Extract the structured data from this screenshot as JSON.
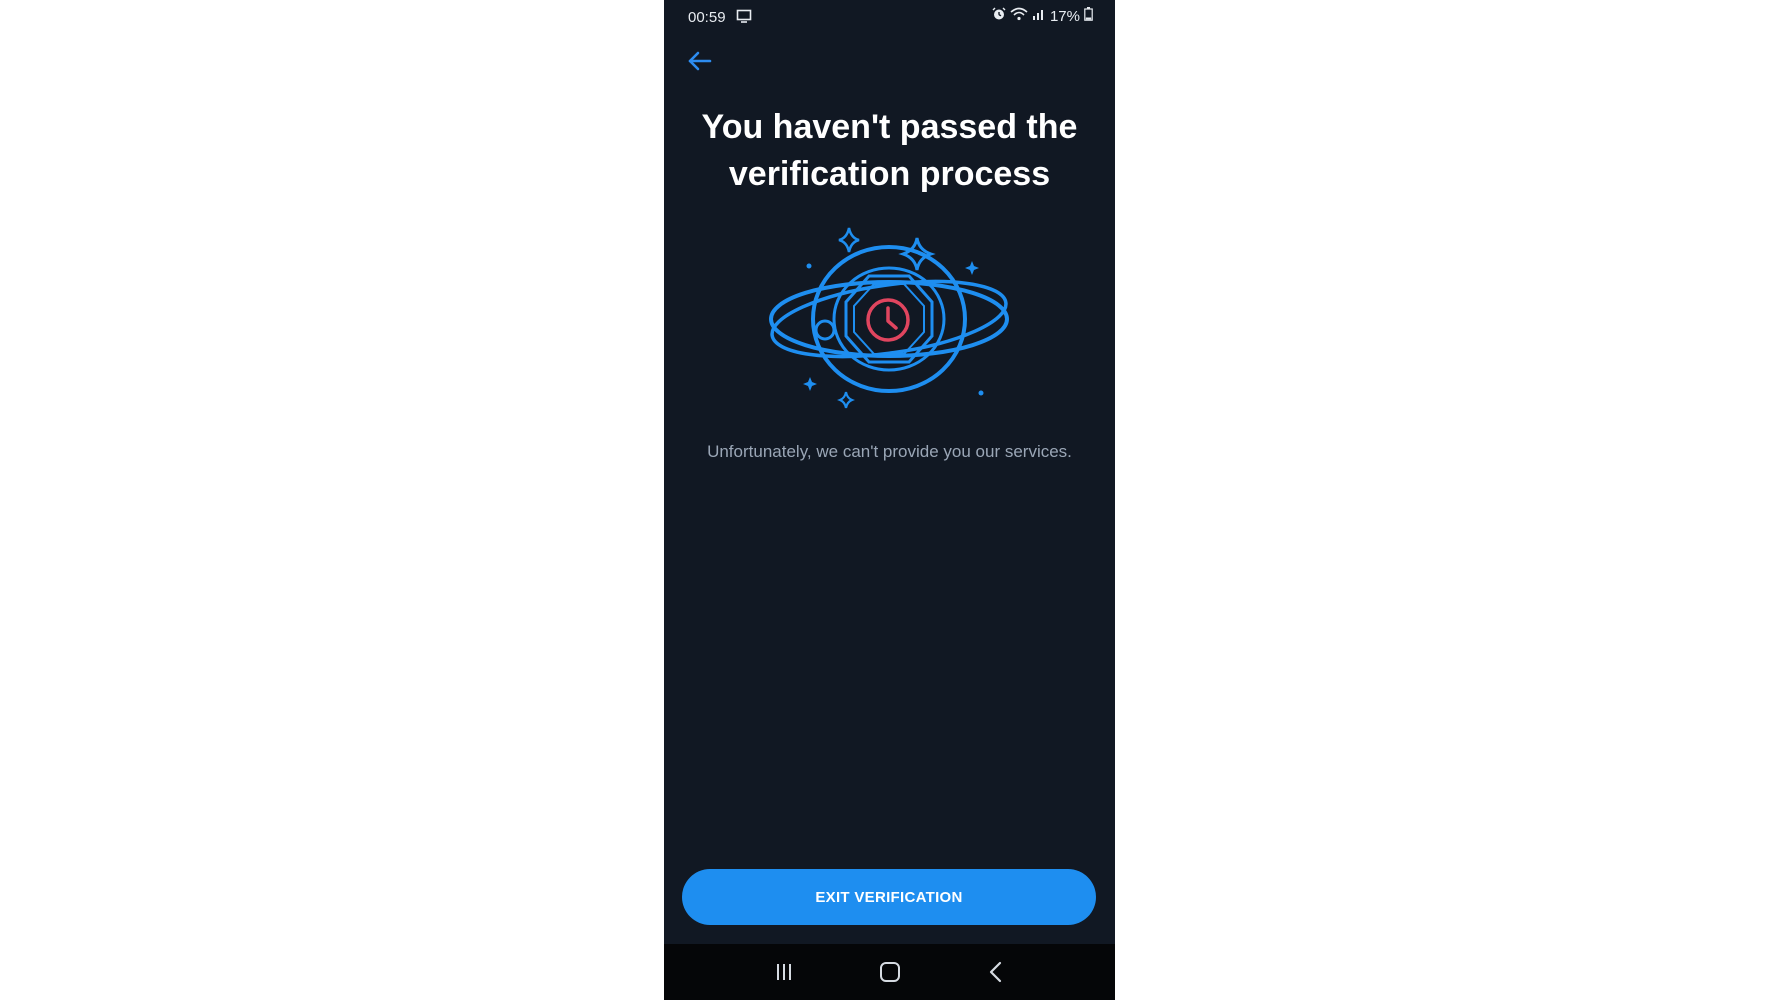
{
  "status_bar": {
    "time": "00:59",
    "battery": "17%",
    "icons": [
      "screen-cast-icon",
      "alarm-icon",
      "wifi-icon",
      "signal-icon",
      "battery-icon"
    ]
  },
  "header": {
    "back_icon": "arrow-left-icon"
  },
  "main": {
    "title": "You haven't passed the verification process",
    "illustration_icon": "clock-planet-icon",
    "message": "Unfortunately, we can't provide you our services."
  },
  "actions": {
    "exit_label": "EXIT VERIFICATION"
  },
  "nav_bar": {
    "icons": [
      "recent-apps-icon",
      "home-icon",
      "back-icon"
    ]
  },
  "colors": {
    "background": "#111823",
    "accent": "#1e8ef0",
    "clock": "#e0455f",
    "text_primary": "#ffffff",
    "text_secondary": "#9aa6b6"
  }
}
